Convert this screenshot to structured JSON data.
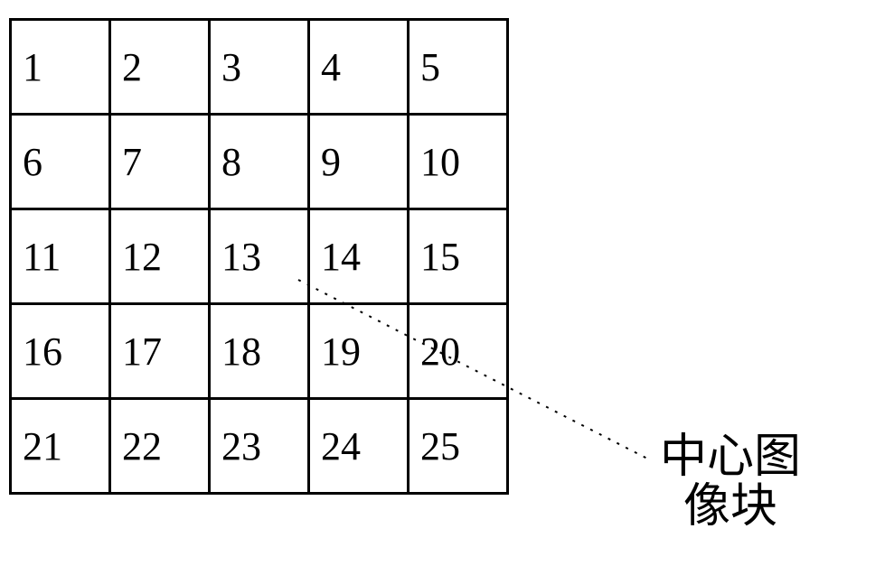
{
  "grid": {
    "rows": [
      [
        "1",
        "2",
        "3",
        "4",
        "5"
      ],
      [
        "6",
        "7",
        "8",
        "9",
        "10"
      ],
      [
        "11",
        "12",
        "13",
        "14",
        "15"
      ],
      [
        "16",
        "17",
        "18",
        "19",
        "20"
      ],
      [
        "21",
        "22",
        "23",
        "24",
        "25"
      ]
    ]
  },
  "caption": {
    "line1": "中心图",
    "line2": "像块"
  }
}
